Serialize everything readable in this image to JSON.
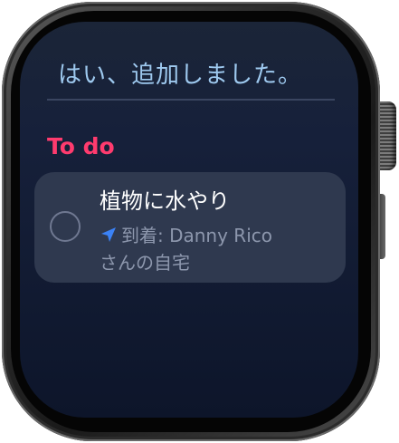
{
  "siri": {
    "response": "はい、追加しました。"
  },
  "list": {
    "section_title": "To do",
    "reminder": {
      "title": "植物に水やり",
      "location_label": "到着: Danny Rico",
      "location_label_2": "さんの自宅"
    }
  },
  "colors": {
    "siri_text": "#9ec9ef",
    "section_title": "#ff3b6e",
    "location_icon": "#3b82f6",
    "card": "#2f394f"
  },
  "icons": {
    "location": "location-arrow-icon",
    "checkbox": "circle-checkbox-icon"
  }
}
